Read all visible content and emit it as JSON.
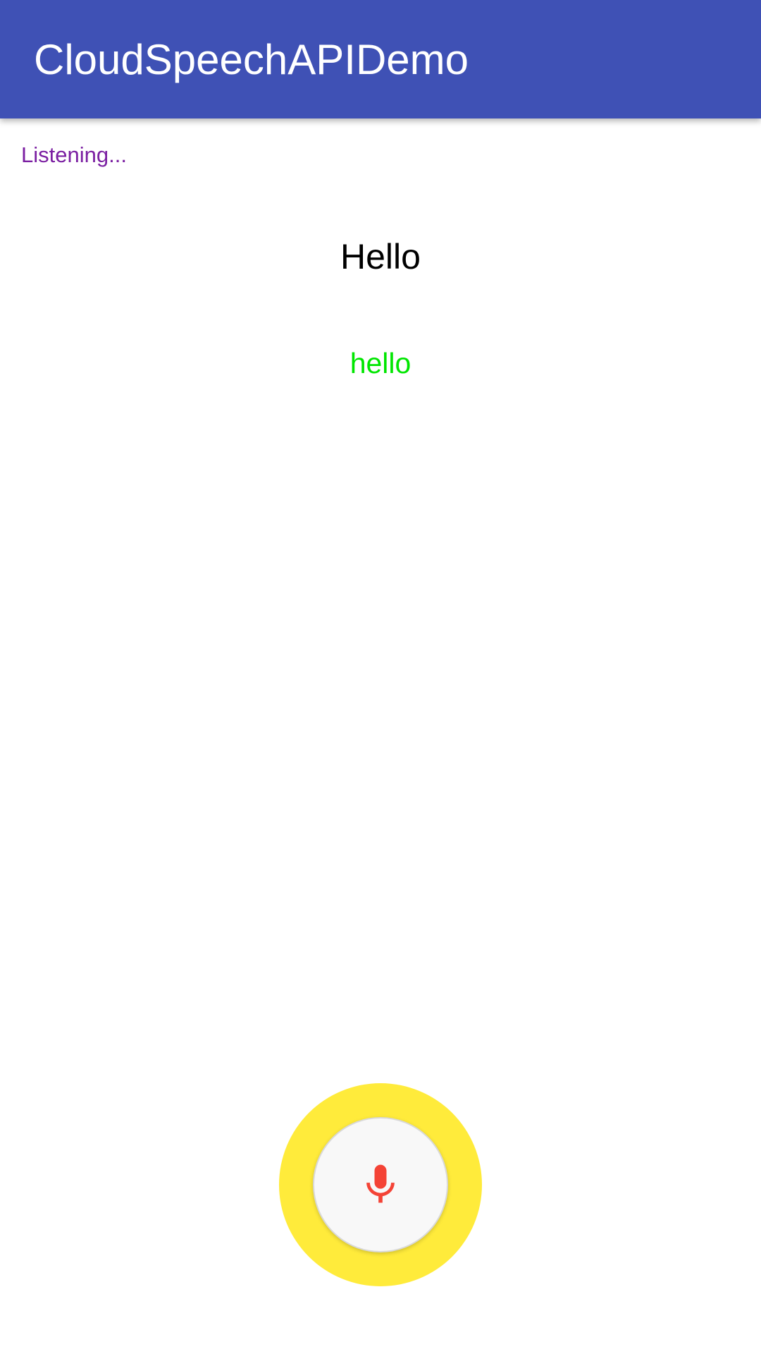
{
  "app_bar": {
    "title": "CloudSpeechAPIDemo",
    "background_color": "#3F51B5"
  },
  "status": {
    "text": "Listening...",
    "color": "#7B1FA2"
  },
  "transcript": {
    "text": "Hello",
    "recognized": "hello",
    "recognized_color": "#00E600"
  },
  "mic": {
    "icon": "microphone-icon",
    "ring_color": "#FFEB3B",
    "icon_color": "#F44336"
  }
}
